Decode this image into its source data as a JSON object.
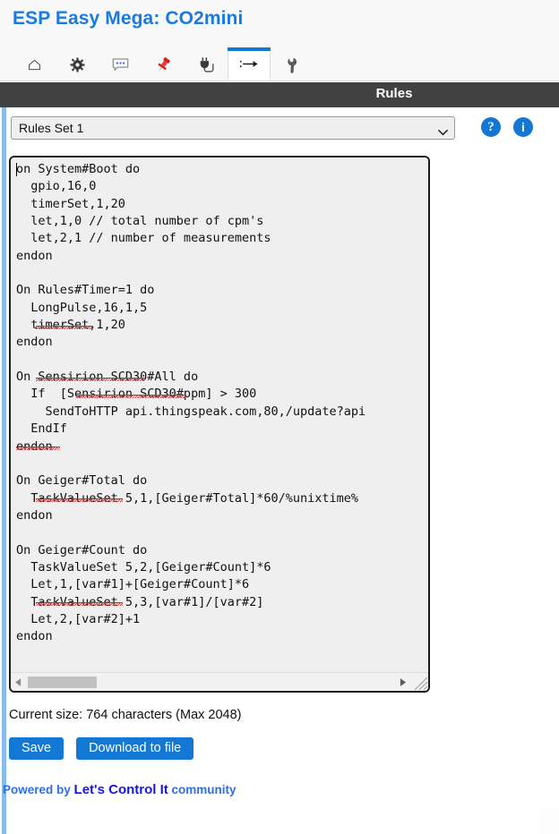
{
  "header": {
    "brand_title": "ESP Easy Mega: CO2mini",
    "brand_color": "#1a7ae0",
    "tabs": [
      {
        "name": "home",
        "icon": "home-icon",
        "active": false
      },
      {
        "name": "config",
        "icon": "gear-icon",
        "active": false
      },
      {
        "name": "controllers",
        "icon": "speech-bubble-icon",
        "active": false
      },
      {
        "name": "hardware",
        "icon": "pushpin-icon",
        "active": false
      },
      {
        "name": "devices",
        "icon": "power-plug-icon",
        "active": false
      },
      {
        "name": "rules",
        "icon": "rules-arrow-icon",
        "active": true
      },
      {
        "name": "tools",
        "icon": "wrench-icon",
        "active": false
      }
    ]
  },
  "section": {
    "title": "Rules",
    "bar_color": "#414141"
  },
  "controls": {
    "ruleset_selected": "Rules Set 1",
    "ruleset_options": [
      "Rules Set 1"
    ],
    "help_icon_label": "?",
    "info_icon_label": "i",
    "accent_color": "#1378d4"
  },
  "editor": {
    "content": "on System#Boot do\n  gpio,16,0\n  timerSet,1,20\n  let,1,0 // total number of cpm's\n  let,2,1 // number of measurements\nendon\n\nOn Rules#Timer=1 do\n  LongPulse,16,1,5\n  timerSet,1,20\nendon\n\nOn Sensirion SCD30#All do\n  If  [Sensirion SCD30#ppm] > 300\n    SendToHTTP api.thingspeak.com,80,/update?api\n  EndIf\nendon\n\nOn Geiger#Total do\n  TaskValueSet 5,1,[Geiger#Total]*60/%unixtime%\nendon\n\nOn Geiger#Count do\n  TaskValueSet 5,2,[Geiger#Count]*6\n  Let,1,[var#1]+[Geiger#Count]*6\n  TaskValueSet 5,3,[var#1]/[var#2]\n  Let,2,[var#2]+1\nendon",
    "scroll_thumb_position": "left"
  },
  "status": {
    "size_text": "Current size: 764 characters (Max 2048)"
  },
  "actions": {
    "save_label": "Save",
    "download_label": "Download to file"
  },
  "footer": {
    "powered_by": "Powered by",
    "brand": "Let's Control It",
    "suffix": "community"
  }
}
